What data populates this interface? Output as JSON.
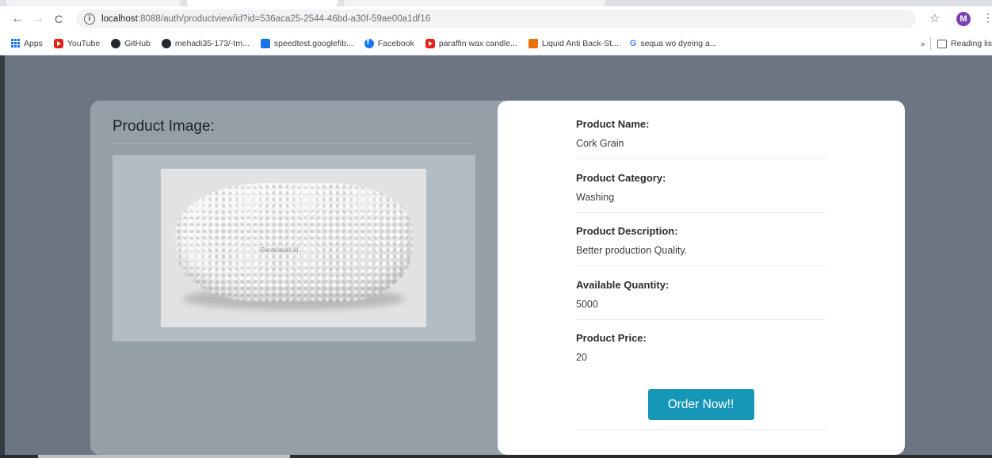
{
  "browser": {
    "url_host": "localhost",
    "url_path": ":8088/auth/productview/id?id=536aca25-2544-46bd-a30f-59ae00a1df16",
    "profile_initial": "M",
    "bookmarks": [
      {
        "label": "Apps",
        "icon": "apps-grid-icon"
      },
      {
        "label": "YouTube",
        "icon": "youtube-icon"
      },
      {
        "label": "GitHub",
        "icon": "github-icon"
      },
      {
        "label": "mehadi35-173/-tm...",
        "icon": "github-icon"
      },
      {
        "label": "speedtest.googlefib...",
        "icon": "speedtest-icon"
      },
      {
        "label": "Facebook",
        "icon": "facebook-icon"
      },
      {
        "label": "paraffin wax candle...",
        "icon": "youtube-icon"
      },
      {
        "label": "Liquid Anti Back-St...",
        "icon": "liquid-icon"
      },
      {
        "label": "sequa wo dyeing a...",
        "icon": "google-icon"
      }
    ],
    "overflow_label": "»",
    "reading_list_label": "Reading lis"
  },
  "image_card": {
    "title": "Product Image:",
    "photo_label": "Bantalsakit.id"
  },
  "details": {
    "fields": [
      {
        "label": "Product Name:",
        "value": "Cork Grain"
      },
      {
        "label": "Product Category:",
        "value": "Washing"
      },
      {
        "label": "Product Description:",
        "value": "Better production Quality."
      },
      {
        "label": "Available Quantity:",
        "value": "5000"
      },
      {
        "label": "Product Price:",
        "value": "20"
      }
    ],
    "order_button": "Order Now!!"
  },
  "colors": {
    "page_bg": "#6b7682",
    "image_card_bg": "#959fa8",
    "details_card_bg": "#ffffff",
    "button_bg": "#1797b8",
    "profile_bg": "#7b3fb0"
  }
}
